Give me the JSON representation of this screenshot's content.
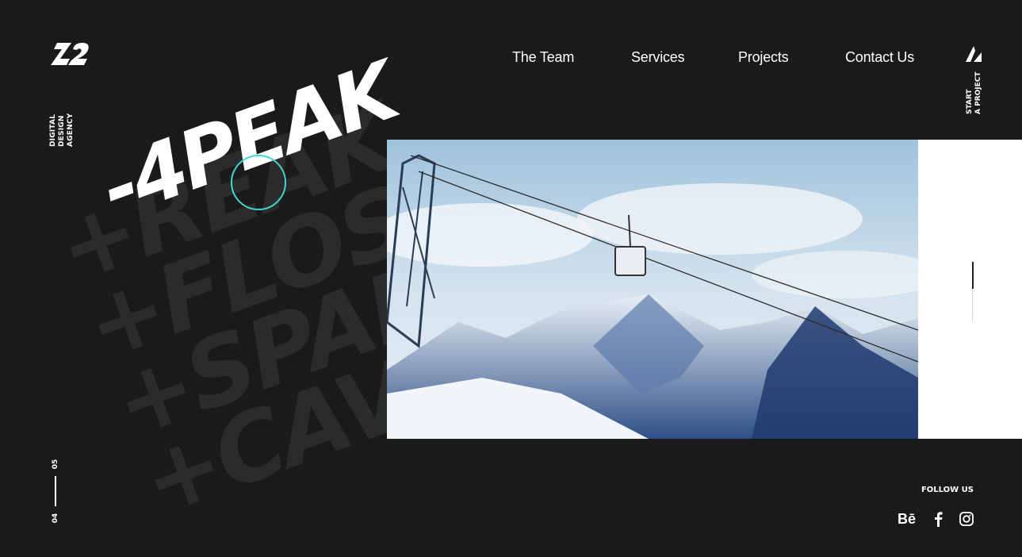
{
  "brand": {
    "logo_text": "42",
    "tagline": "DIGITAL\nDESIGN\nAGENCY"
  },
  "nav": {
    "items": [
      {
        "label": "The Team"
      },
      {
        "label": "Services"
      },
      {
        "label": "Projects"
      },
      {
        "label": "Contact Us"
      }
    ]
  },
  "cta": {
    "label": "START\nA PROJECT"
  },
  "hero": {
    "headline": "-4PEAK",
    "background_words": [
      "+REAK",
      "+FLOS",
      "+SPAR",
      "+CAVIO"
    ]
  },
  "slider": {
    "current": "04",
    "total": "05"
  },
  "follow": {
    "label": "FOLLOW US"
  },
  "social": [
    {
      "icon": "behance-icon",
      "glyph": "Bē"
    },
    {
      "icon": "facebook-icon",
      "glyph": "f"
    },
    {
      "icon": "instagram-icon",
      "glyph": ""
    }
  ],
  "colors": {
    "background": "#1a1a1a",
    "accent": "#3fd7d0",
    "text": "#ffffff"
  }
}
